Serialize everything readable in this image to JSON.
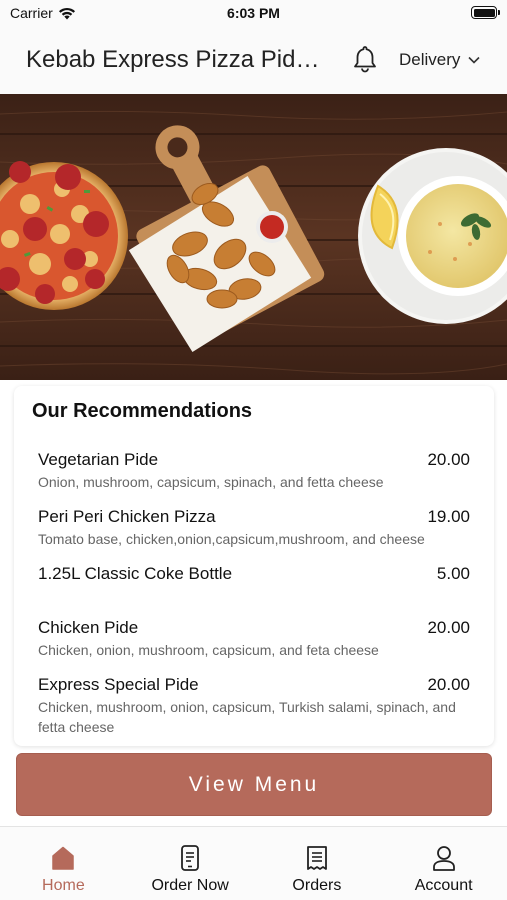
{
  "status_bar": {
    "carrier": "Carrier",
    "time": "6:03 PM"
  },
  "header": {
    "title": "Kebab Express Pizza Pide…",
    "delivery_label": "Delivery"
  },
  "recommendations": {
    "title": "Our Recommendations",
    "items": [
      {
        "name": "Vegetarian Pide",
        "price": "20.00",
        "description": "Onion, mushroom, capsicum, spinach, and fetta cheese"
      },
      {
        "name": "Peri Peri Chicken Pizza",
        "price": "19.00",
        "description": "Tomato base, chicken,onion,capsicum,mushroom, and cheese"
      },
      {
        "name": "1.25L Classic Coke Bottle",
        "price": "5.00",
        "description": ""
      },
      {
        "name": "Chicken Pide",
        "price": "20.00",
        "description": "Chicken, onion, mushroom, capsicum, and feta cheese"
      },
      {
        "name": "Express Special Pide",
        "price": "20.00",
        "description": "Chicken, mushroom, onion, capsicum, Turkish salami, spinach, and fetta cheese"
      }
    ]
  },
  "view_menu_label": "View Menu",
  "tabs": [
    {
      "label": "Home",
      "icon": "home-icon",
      "active": true
    },
    {
      "label": "Order Now",
      "icon": "phone-order-icon",
      "active": false
    },
    {
      "label": "Orders",
      "icon": "receipt-icon",
      "active": false
    },
    {
      "label": "Account",
      "icon": "person-icon",
      "active": false
    }
  ],
  "colors": {
    "accent": "#b56a5b",
    "card_bg": "#ffffff",
    "header_bg": "#fafafa"
  }
}
